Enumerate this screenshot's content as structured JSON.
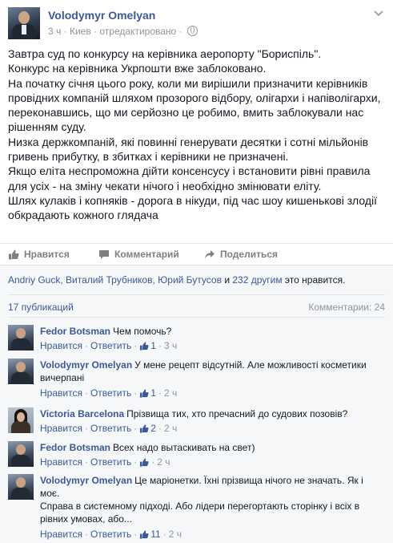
{
  "post": {
    "author": "Volodymyr Omelyan",
    "time": "3 ч",
    "location": "Киев",
    "edited": "отредактировано",
    "paragraphs": [
      "Завтра суд по конкурсу на керівника аеропорту \"Бориспіль\".",
      "Конкурс на керівника Укрпошти вже заблоковано.",
      "На початку січня цього року, коли ми вирішили призначити керівників провідних компаній шляхом прозорого відбору, олігархи і напіволігархи, переконавшись, що ми серйозно це робимо, вмить заблокували нас рішенням суду.",
      "Низка держкомпаній, які повинні генерувати десятки і сотні мільйонів гривень прибутку, в збитках і керівники не призначені.",
      "Якщо еліта неспроможна дійти консенсусу і встановити рівні правила для усіх - на зміну чекати нічого і необхідно змінювати еліту.",
      "Шлях кулаків і копняків - дорога в нікуди, під час шоу кишенькові злодії обкрадають кожного глядача"
    ]
  },
  "actions": {
    "like": "Нравится",
    "comment": "Комментарий",
    "share": "Поделиться"
  },
  "likes": {
    "names": "Andriy Guck, Виталий Трубников, Юрий Бутусов",
    "and": " и ",
    "others": "232 другим",
    "suffix": " это нравится."
  },
  "counts": {
    "publications": "17 публикаций",
    "comments": "Комментарии: 24"
  },
  "comment_actions": {
    "like": "Нравится",
    "reply": "Ответить",
    "sep": "·"
  },
  "comments": [
    {
      "name": "Fedor Botsman",
      "text": "Чем помочь?",
      "likes": "1",
      "time": "3 ч"
    },
    {
      "name": "Volodymyr Omelyan",
      "text": "У мене рецепт відсутній. Але можливості косметики вичерпані",
      "likes": "1",
      "time": "2 ч"
    },
    {
      "name": "Victoria Barcelona",
      "text": "Прізвища тих, хто пречасний до судових позовів?",
      "likes": "2",
      "time": "2 ч"
    },
    {
      "name": "Fedor Botsman",
      "text": "Всех надо вытаскивать на свет)",
      "likes": "",
      "time": "2 ч"
    },
    {
      "name": "Volodymyr Omelyan",
      "text": "Це маріонетки. Їхні прізвища нічого не значать. Як і моє.",
      "text2": "Справа в системному підході. Або лідери перегортають сторінку і всіх в рівних умовах, або...",
      "likes": "11",
      "time": "2 ч"
    }
  ]
}
